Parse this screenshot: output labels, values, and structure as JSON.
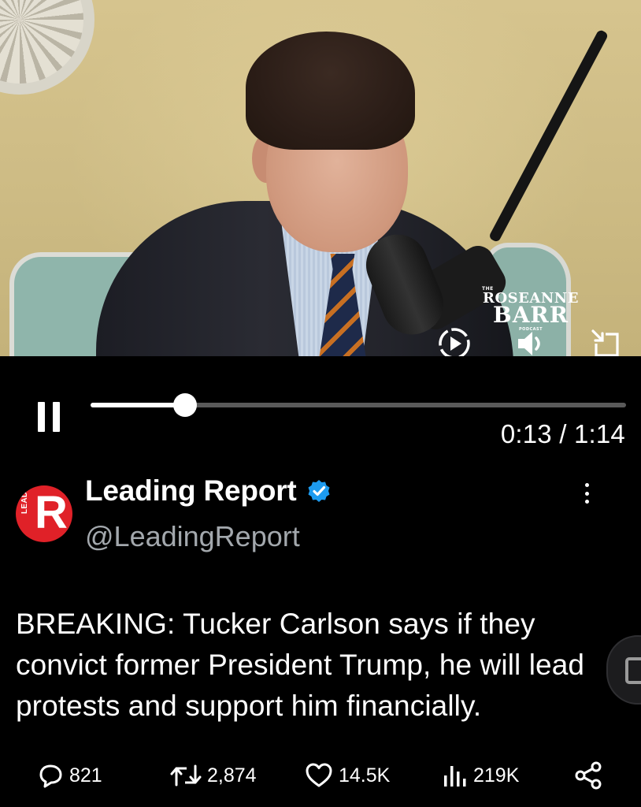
{
  "video": {
    "overlay_logo": {
      "line_small_top": "THE",
      "line1": "ROSEANNE",
      "line2": "BARR",
      "line_small_bottom": "PODCAST"
    },
    "controls": {
      "current_time": "0:13",
      "duration": "1:14",
      "time_display": "0:13 / 1:14",
      "progress_fraction": 0.176
    },
    "icons": {
      "autoplay": "play-circle-dashed-icon",
      "volume": "speaker-icon",
      "minimize": "pip-minimize-icon",
      "pause": "pause-icon"
    }
  },
  "tweet": {
    "author": {
      "name": "Leading Report",
      "handle": "@LeadingReport",
      "verified": true,
      "verified_color": "#1d9bf0",
      "avatar": {
        "letter": "R",
        "vertical_text": "LEADING",
        "color": "#e02128"
      }
    },
    "text": "BREAKING: Tucker Carlson says if they convict former President Trump, he will lead protests and support him financially."
  },
  "actions": {
    "replies": "821",
    "reposts": "2,874",
    "likes": "14.5K",
    "views": "219K",
    "icons": [
      "reply-icon",
      "repost-icon",
      "like-icon",
      "views-icon",
      "share-icon"
    ]
  }
}
